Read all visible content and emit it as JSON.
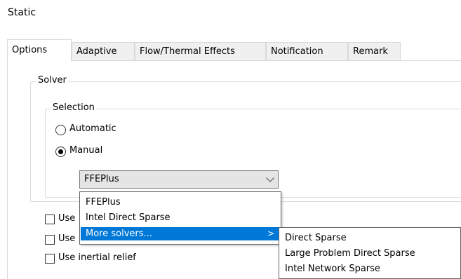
{
  "window": {
    "title": "Static"
  },
  "tabs": [
    {
      "label": "Options",
      "active": true
    },
    {
      "label": "Adaptive",
      "active": false
    },
    {
      "label": "Flow/Thermal Effects",
      "active": false
    },
    {
      "label": "Notification",
      "active": false
    },
    {
      "label": "Remark",
      "active": false
    }
  ],
  "solver_group": {
    "legend": "Solver",
    "selection_group": {
      "legend": "Selection",
      "radios": [
        {
          "label": "Automatic",
          "checked": false
        },
        {
          "label": "Manual",
          "checked": true
        }
      ]
    },
    "combo": {
      "value": "FFEPlus"
    }
  },
  "dropdown": {
    "items": [
      {
        "label": "FFEPlus",
        "highlighted": false
      },
      {
        "label": "Intel Direct Sparse",
        "highlighted": false
      },
      {
        "label": "More solvers...",
        "highlighted": true,
        "arrow": ">"
      }
    ],
    "highlight_color": "#0078d7"
  },
  "submenu": {
    "items": [
      {
        "label": "Direct Sparse"
      },
      {
        "label": "Large Problem Direct Sparse"
      },
      {
        "label": "Intel Network Sparse"
      }
    ]
  },
  "checkboxes": [
    {
      "label_visible": "Use",
      "checked": false
    },
    {
      "label_visible": "Use",
      "checked": false
    },
    {
      "label_visible": "Use inertial relief",
      "checked": false
    }
  ],
  "icons": {
    "combo_arrow": "chevron-down-icon",
    "submenu_arrow": "chevron-right-icon"
  }
}
